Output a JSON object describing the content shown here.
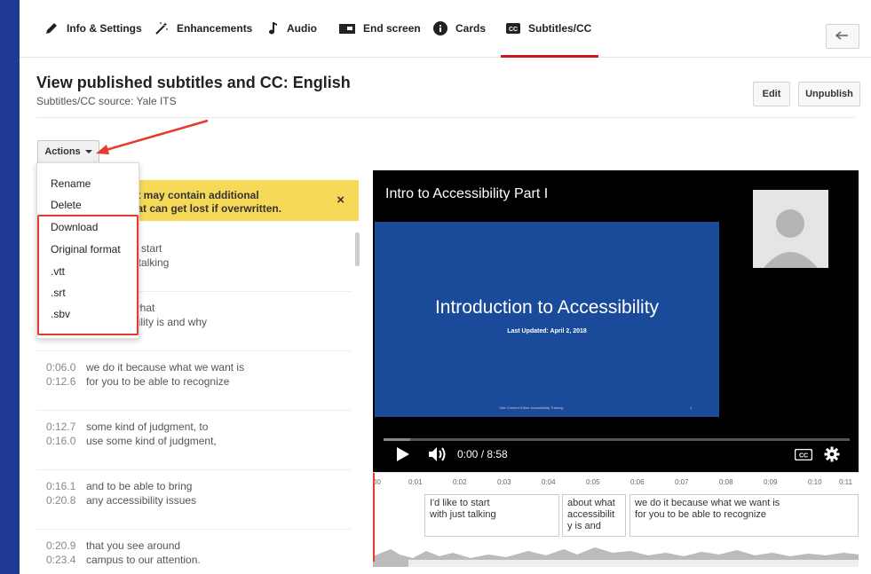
{
  "tabs": [
    {
      "label": "Info & Settings",
      "icon": "pencil-icon"
    },
    {
      "label": "Enhancements",
      "icon": "magic-wand-icon"
    },
    {
      "label": "Audio",
      "icon": "music-note-icon"
    },
    {
      "label": "End screen",
      "icon": "end-screen-icon"
    },
    {
      "label": "Cards",
      "icon": "info-icon"
    },
    {
      "label": "Subtitles/CC",
      "icon": "cc-icon",
      "active": true
    }
  ],
  "header": {
    "title": "View published subtitles and CC: English",
    "subtitle": "Subtitles/CC source: Yale ITS",
    "edit_label": "Edit",
    "unpublish_label": "Unpublish"
  },
  "actions": {
    "label": "Actions",
    "menu": [
      "Rename",
      "Delete",
      "Download",
      "Original format",
      ".vtt",
      ".srt",
      ".sbv"
    ]
  },
  "warning": {
    "line1": "pt may contain additional",
    "line2": "hat can get lost if overwritten.",
    "close": "×"
  },
  "transcript": [
    {
      "start": "",
      "end": "",
      "line1": "o start",
      "line2": "t talking"
    },
    {
      "start": "",
      "end": "",
      "line1": "what",
      "line2": "bility is and why"
    },
    {
      "start": "0:06.0",
      "end": "0:12.6",
      "line1": "we do it because what we want is",
      "line2": "for you to be able to recognize"
    },
    {
      "start": "0:12.7",
      "end": "0:16.0",
      "line1": "some kind of judgment, to",
      "line2": "use some kind of judgment,"
    },
    {
      "start": "0:16.1",
      "end": "0:20.8",
      "line1": "and to be able to bring",
      "line2": "any accessibility issues"
    },
    {
      "start": "0:20.9",
      "end": "0:23.4",
      "line1": "that you see around",
      "line2": "campus to our attention."
    }
  ],
  "player": {
    "title": "Intro to Accessibility Part I",
    "slide_title": "Introduction to Accessibility",
    "slide_date": "Last Updated: April 2, 2018",
    "slide_footer": "Yale Content Editor Accessibility Training",
    "slide_number": "1",
    "time": "0:00 / 8:58",
    "progress": 0
  },
  "timeline": {
    "ticks": [
      "00",
      "0:01",
      "0:02",
      "0:03",
      "0:04",
      "0:05",
      "0:06",
      "0:07",
      "0:08",
      "0:09",
      "0:10",
      "0:11"
    ],
    "captions": [
      {
        "line1": "I'd like to start",
        "line2": "with just talking",
        "line3": ""
      },
      {
        "line1": "about what",
        "line2": "accessibilit",
        "line3": "y is and"
      },
      {
        "line1": "we do it because what we want is",
        "line2": "for you to be able to recognize",
        "line3": ""
      }
    ]
  },
  "colors": {
    "accent": "#cc181e",
    "background": "#1f3a93",
    "warning": "#f7d95a",
    "annotation": "#e53a2e",
    "slide": "#1a4a9a"
  }
}
